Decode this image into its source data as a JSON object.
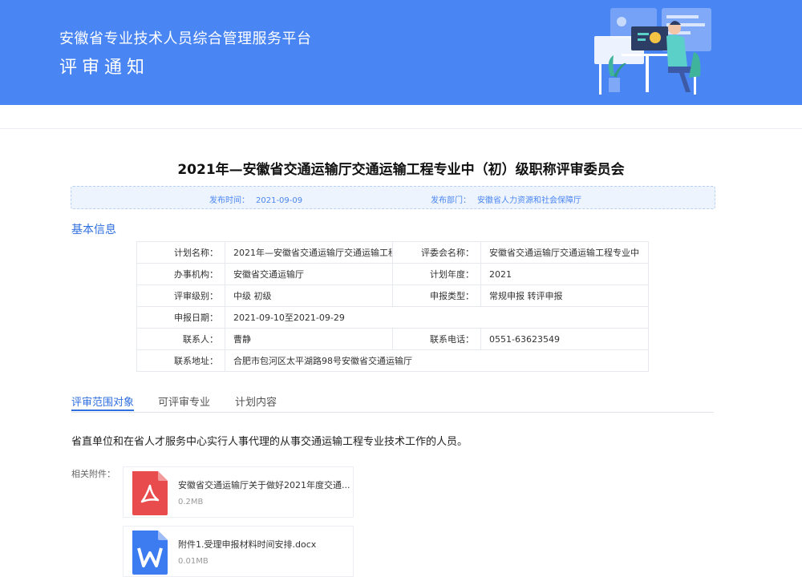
{
  "header": {
    "platform_title": "安徽省专业技术人员综合管理服务平台",
    "page_title": "评审通知"
  },
  "notice": {
    "title": "2021年—安徽省交通运输厅交通运输工程专业中（初）级职称评审委员会",
    "publish_time_label": "发布时间：",
    "publish_time": "2021-09-09",
    "department_label": "发布部门：",
    "department": "安徽省人力资源和社会保障厅"
  },
  "basic_info": {
    "section_title": "基本信息",
    "rows": [
      {
        "l1": "计划名称：",
        "v1": "2021年—安徽省交通运输厅交通运输工程",
        "l2": "评委会名称：",
        "v2": "安徽省交通运输厅交通运输工程专业中"
      },
      {
        "l1": "办事机构：",
        "v1": "安徽省交通运输厅",
        "l2": "计划年度：",
        "v2": "2021"
      },
      {
        "l1": "评审级别：",
        "v1": "中级 初级",
        "l2": "申报类型：",
        "v2": "常规申报 转评申报"
      },
      {
        "l1": "申报日期：",
        "v1": "2021-09-10至2021-09-29"
      },
      {
        "l1": "联系人：",
        "v1": "曹静",
        "l2": "联系电话：",
        "v2": "0551-63623549"
      },
      {
        "l1": "联系地址：",
        "v1": "合肥市包河区太平湖路98号安徽省交通运输厅"
      }
    ]
  },
  "tabs": [
    "评审范围对象",
    "可评审专业",
    "计划内容"
  ],
  "content": {
    "description": "省直单位和在省人才服务中心实行人事代理的从事交通运输工程专业技术工作的人员。",
    "attachments_label": "相关附件：",
    "attachments": [
      {
        "name": "安徽省交通运输厅关于做好2021年度交通...",
        "size": "0.2MB",
        "icon": "pdf-icon"
      },
      {
        "name": "附件1.受理申报材料时间安排.docx",
        "size": "0.01MB",
        "icon": "word-icon"
      }
    ]
  },
  "colors": {
    "primary": "#4a86f3",
    "accent": "#2f6fe0",
    "pdf": "#e84c4c",
    "word": "#3d7bf0"
  }
}
